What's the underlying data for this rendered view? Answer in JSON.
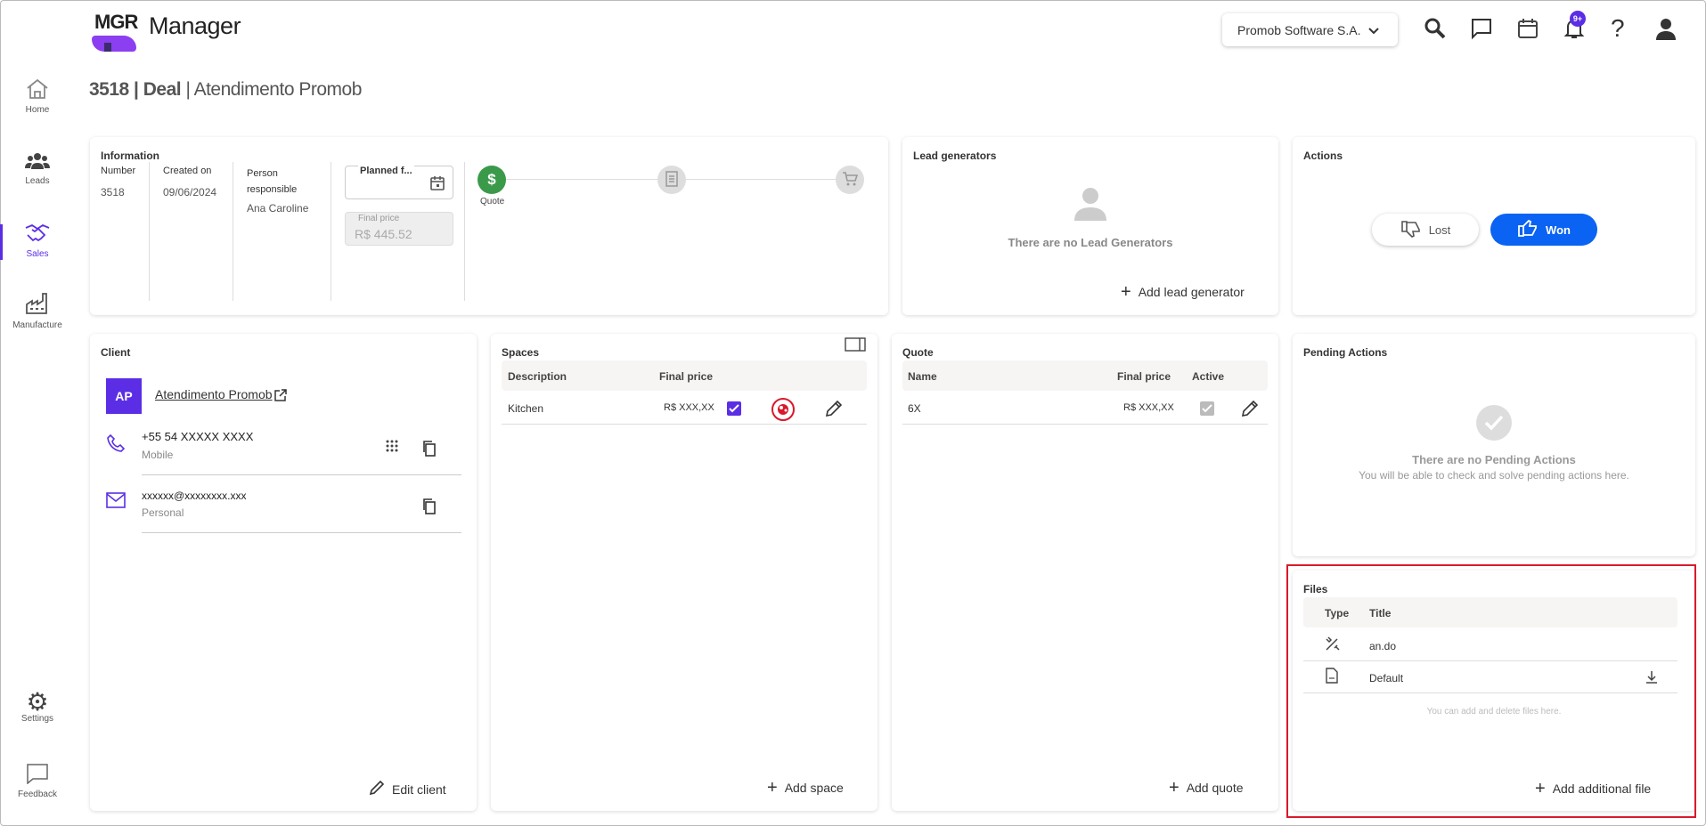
{
  "app": {
    "logo": "MGR",
    "title": "Manager"
  },
  "header": {
    "company": "Promob Software S.A.",
    "notif_badge": "9+"
  },
  "sidebar": {
    "items": [
      {
        "label": "Home"
      },
      {
        "label": "Leads"
      },
      {
        "label": "Sales"
      },
      {
        "label": "Manufacture"
      }
    ],
    "settings": "Settings",
    "feedback": "Feedback"
  },
  "page": {
    "id": "3518",
    "type": "Deal",
    "name": "Atendimento Promob",
    "sep": " | "
  },
  "information": {
    "title": "Information",
    "number_label": "Number",
    "number": "3518",
    "created_label": "Created on",
    "created": "09/06/2024",
    "person_label": "Person responsible",
    "person": "Ana Caroline",
    "planned_label": "Planned f...",
    "final_price_label": "Final price",
    "final_price": "R$ 445.52",
    "step_quote": "Quote"
  },
  "lead_generators": {
    "title": "Lead generators",
    "empty": "There are no Lead Generators",
    "add": "Add lead generator"
  },
  "actions": {
    "title": "Actions",
    "lost": "Lost",
    "won": "Won"
  },
  "client": {
    "title": "Client",
    "initials": "AP",
    "name": "Atendimento Promob",
    "phone": "+55 54 XXXXX XXXX",
    "phone_type": "Mobile",
    "email": "xxxxxx@xxxxxxxx.xxx",
    "email_type": "Personal",
    "edit": "Edit client"
  },
  "spaces": {
    "title": "Spaces",
    "col_desc": "Description",
    "col_price": "Final price",
    "rows": [
      {
        "desc": "Kitchen",
        "price": "R$ XXX,XX"
      }
    ],
    "add": "Add space"
  },
  "quote": {
    "title": "Quote",
    "col_name": "Name",
    "col_price": "Final price",
    "col_active": "Active",
    "rows": [
      {
        "name": "6X",
        "price": "R$ XXX,XX"
      }
    ],
    "add": "Add quote"
  },
  "pending": {
    "title": "Pending Actions",
    "empty": "There are no Pending Actions",
    "hint": "You will be able to check and solve pending actions here."
  },
  "files": {
    "title": "Files",
    "col_type": "Type",
    "col_title": "Title",
    "rows": [
      {
        "title": "an.do"
      },
      {
        "title": "Default"
      }
    ],
    "hint": "You can add and delete files here.",
    "add": "Add additional file"
  },
  "colors": {
    "accent": "#5b2ee5",
    "won": "#0a63f2",
    "quote_green": "#3a9a4a",
    "highlight": "#d9192c"
  }
}
